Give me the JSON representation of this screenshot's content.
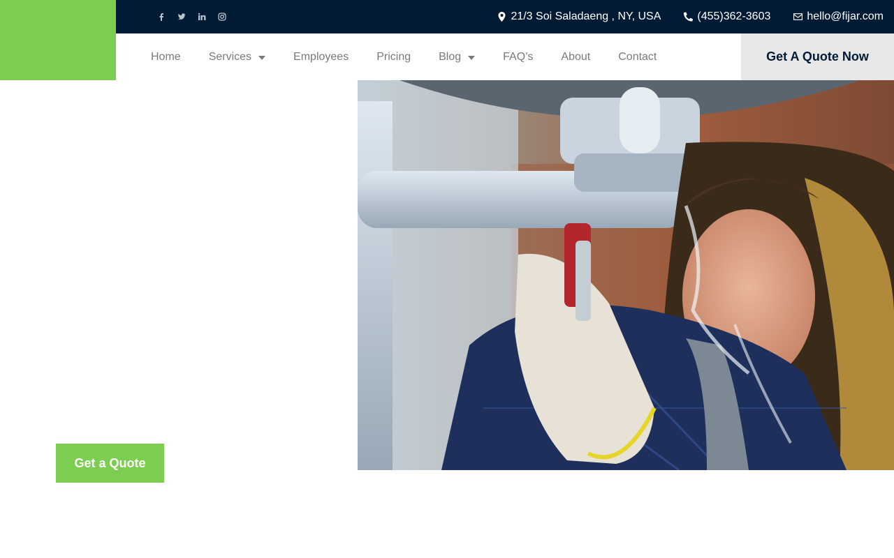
{
  "topbar": {
    "socials": [
      {
        "icon": "facebook-icon",
        "glyph": "f"
      },
      {
        "icon": "twitter-icon",
        "glyph": "t"
      },
      {
        "icon": "linkedin-icon",
        "glyph": "in"
      },
      {
        "icon": "instagram-icon",
        "glyph": "ig"
      }
    ],
    "address": "21/3 Soi Saladaeng , NY, USA",
    "phone": "(455)362-3603",
    "email": "hello@fijar.com"
  },
  "nav": {
    "items": [
      {
        "label": "Home",
        "has_dropdown": false
      },
      {
        "label": "Services",
        "has_dropdown": true
      },
      {
        "label": "Employees",
        "has_dropdown": false
      },
      {
        "label": "Pricing",
        "has_dropdown": false
      },
      {
        "label": "Blog",
        "has_dropdown": true
      },
      {
        "label": "FAQ’s",
        "has_dropdown": false
      },
      {
        "label": "About",
        "has_dropdown": false
      },
      {
        "label": "Contact",
        "has_dropdown": false
      }
    ],
    "cta_label": "Get A Quote Now"
  },
  "hero": {
    "cta_label": "Get a Quote"
  },
  "colors": {
    "brand_green": "#7ccd50",
    "navy": "#011b35",
    "nav_text": "#7a7a7a",
    "cta_grey": "#e8e8e8"
  }
}
